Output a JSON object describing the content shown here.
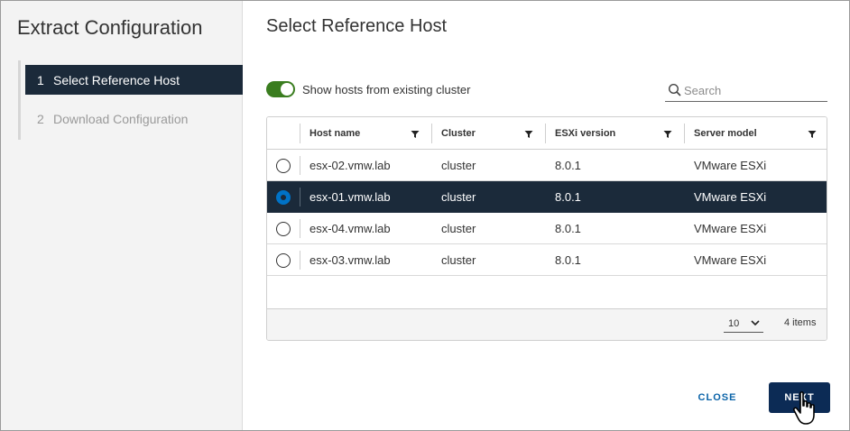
{
  "dialog": {
    "title": "Extract Configuration",
    "steps": [
      {
        "num": "1",
        "label": "Select Reference Host",
        "active": true
      },
      {
        "num": "2",
        "label": "Download Configuration",
        "active": false
      }
    ]
  },
  "main": {
    "title": "Select Reference Host",
    "toggle_label": "Show hosts from existing cluster",
    "toggle_on": true,
    "search_placeholder": "Search"
  },
  "grid": {
    "columns": [
      "Host name",
      "Cluster",
      "ESXi version",
      "Server model"
    ],
    "rows": [
      {
        "host": "esx-02.vmw.lab",
        "cluster": "cluster",
        "version": "8.0.1",
        "model": "VMware ESXi",
        "selected": false
      },
      {
        "host": "esx-01.vmw.lab",
        "cluster": "cluster",
        "version": "8.0.1",
        "model": "VMware ESXi",
        "selected": true
      },
      {
        "host": "esx-04.vmw.lab",
        "cluster": "cluster",
        "version": "8.0.1",
        "model": "VMware ESXi",
        "selected": false
      },
      {
        "host": "esx-03.vmw.lab",
        "cluster": "cluster",
        "version": "8.0.1",
        "model": "VMware ESXi",
        "selected": false
      }
    ],
    "page_size": "10",
    "items_count": "4 items"
  },
  "buttons": {
    "close_label": "CLOSE",
    "next_label": "NEXT"
  },
  "colors": {
    "selected_row": "#1b2a3a",
    "toggle_on": "#3a7d1f",
    "primary_button": "#0c2b55",
    "link": "#0a63a8"
  }
}
